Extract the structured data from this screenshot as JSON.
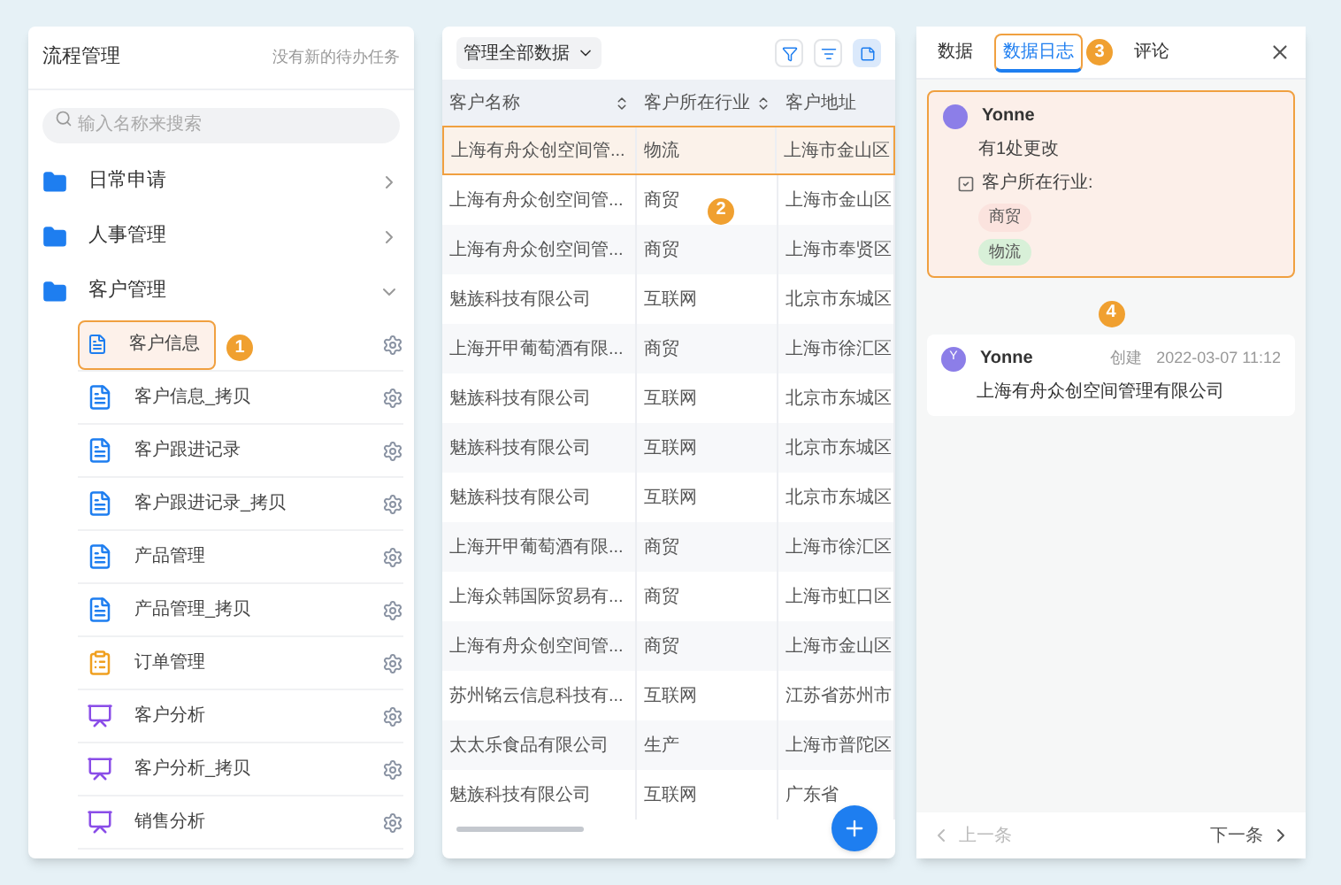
{
  "left_panel": {
    "title": "流程管理",
    "notice": "没有新的待办任务",
    "search": {
      "placeholder": "输入名称来搜索"
    },
    "folders": [
      {
        "label": "日常申请",
        "expanded": false
      },
      {
        "label": "人事管理",
        "expanded": false
      },
      {
        "label": "客户管理",
        "expanded": true,
        "children": [
          {
            "label": "客户信息",
            "kind": "doc",
            "highlighted": true,
            "marker": "1"
          },
          {
            "label": "客户信息_拷贝",
            "kind": "doc",
            "highlighted": false
          },
          {
            "label": "客户跟进记录",
            "kind": "doc",
            "highlighted": false
          },
          {
            "label": "客户跟进记录_拷贝",
            "kind": "doc",
            "highlighted": false
          },
          {
            "label": "产品管理",
            "kind": "doc",
            "highlighted": false
          },
          {
            "label": "产品管理_拷贝",
            "kind": "doc",
            "highlighted": false
          },
          {
            "label": "订单管理",
            "kind": "order",
            "highlighted": false
          },
          {
            "label": "客户分析",
            "kind": "chart",
            "highlighted": false
          },
          {
            "label": "客户分析_拷贝",
            "kind": "chart",
            "highlighted": false
          },
          {
            "label": "销售分析",
            "kind": "chart",
            "highlighted": false
          }
        ]
      }
    ]
  },
  "table_panel": {
    "scope_dropdown": "管理全部数据",
    "marker": "2",
    "columns": [
      {
        "label": "客户名称",
        "sortable": true
      },
      {
        "label": "客户所在行业",
        "sortable": true
      },
      {
        "label": "客户地址",
        "sortable": false
      }
    ],
    "rows": [
      {
        "cells": [
          "上海有舟众创空间管...",
          "物流",
          "上海市金山区"
        ],
        "highlighted": true
      },
      {
        "cells": [
          "上海有舟众创空间管...",
          "商贸",
          "上海市金山区"
        ],
        "highlighted": false
      },
      {
        "cells": [
          "上海有舟众创空间管...",
          "商贸",
          "上海市奉贤区"
        ],
        "highlighted": false
      },
      {
        "cells": [
          "魅族科技有限公司",
          "互联网",
          "北京市东城区"
        ],
        "highlighted": false
      },
      {
        "cells": [
          "上海开甲葡萄酒有限...",
          "商贸",
          "上海市徐汇区"
        ],
        "highlighted": false
      },
      {
        "cells": [
          "魅族科技有限公司",
          "互联网",
          "北京市东城区"
        ],
        "highlighted": false
      },
      {
        "cells": [
          "魅族科技有限公司",
          "互联网",
          "北京市东城区"
        ],
        "highlighted": false
      },
      {
        "cells": [
          "魅族科技有限公司",
          "互联网",
          "北京市东城区"
        ],
        "highlighted": false
      },
      {
        "cells": [
          "上海开甲葡萄酒有限...",
          "商贸",
          "上海市徐汇区"
        ],
        "highlighted": false
      },
      {
        "cells": [
          "上海众韩国际贸易有...",
          "商贸",
          "上海市虹口区"
        ],
        "highlighted": false
      },
      {
        "cells": [
          "上海有舟众创空间管...",
          "商贸",
          "上海市金山区"
        ],
        "highlighted": false
      },
      {
        "cells": [
          "苏州铭云信息科技有...",
          "互联网",
          "江苏省苏州市"
        ],
        "highlighted": false
      },
      {
        "cells": [
          "太太乐食品有限公司",
          "生产",
          "上海市普陀区"
        ],
        "highlighted": false
      },
      {
        "cells": [
          "魅族科技有限公司",
          "互联网",
          "广东省"
        ],
        "highlighted": false
      }
    ]
  },
  "detail_panel": {
    "tabs": [
      {
        "label": "数据",
        "selected": false,
        "highlighted": false
      },
      {
        "label": "数据日志",
        "selected": true,
        "highlighted": true,
        "marker": "3"
      },
      {
        "label": "评论",
        "selected": false,
        "highlighted": false
      }
    ],
    "log_entries": [
      {
        "user": "Yonne",
        "highlighted": true,
        "summary": "有1处更改",
        "field": "客户所在行业:",
        "tags": [
          {
            "label": "商贸",
            "color": "#fbe3de"
          },
          {
            "label": "物流",
            "color": "#d8f0d8"
          }
        ]
      },
      {
        "user": "Yonne",
        "avatar": "Y",
        "highlighted": false,
        "marker": "4",
        "action": "创建",
        "time": "2022-03-07 11:12",
        "content": "上海有舟众创空间管理有限公司"
      }
    ],
    "prev": {
      "label": "上一条",
      "disabled": true
    },
    "next": {
      "label": "下一条",
      "disabled": false
    }
  }
}
